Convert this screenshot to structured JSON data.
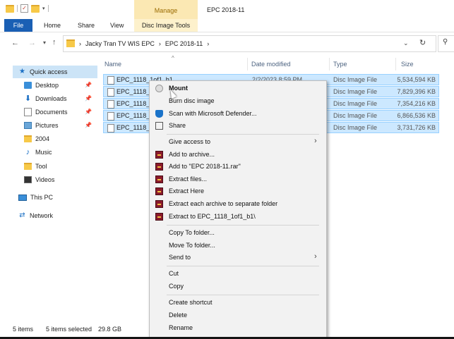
{
  "window": {
    "title": "EPC 2018-11",
    "manage_label": "Manage",
    "ribbon_tabs": [
      "File",
      "Home",
      "Share",
      "View",
      "Disc Image Tools"
    ]
  },
  "address": {
    "crumbs": [
      "Jacky Tran TV WIS EPC",
      "EPC 2018-11"
    ]
  },
  "nav": {
    "quick_access": "Quick access",
    "items": [
      "Desktop",
      "Downloads",
      "Documents",
      "Pictures",
      "2004",
      "Music",
      "Tool",
      "Videos"
    ],
    "this_pc": "This PC",
    "network": "Network"
  },
  "columns": {
    "name": "Name",
    "date": "Date modified",
    "type": "Type",
    "size": "Size"
  },
  "files": [
    {
      "name": "EPC_1118_1of1_b1",
      "date": "2/2/2023 8:59 PM",
      "type": "Disc Image File",
      "size": "5,534,594 KB"
    },
    {
      "name": "EPC_1118_",
      "date": "",
      "type": "Disc Image File",
      "size": "7,829,396 KB"
    },
    {
      "name": "EPC_1118_2",
      "date": "",
      "type": "Disc Image File",
      "size": "7,354,216 KB"
    },
    {
      "name": "EPC_1118_",
      "date": "",
      "type": "Disc Image File",
      "size": "6,866,536 KB"
    },
    {
      "name": "EPC_1118_4",
      "date": "",
      "type": "Disc Image File",
      "size": "3,731,726 KB"
    }
  ],
  "status": {
    "count": "5 items",
    "selected": "5 items selected",
    "size": "29.8 GB"
  },
  "context_menu": {
    "mount": "Mount",
    "burn": "Burn disc image",
    "defender": "Scan with Microsoft Defender...",
    "share": "Share",
    "give_access": "Give access to",
    "add_archive": "Add to archive...",
    "add_rar": "Add to \"EPC 2018-11.rar\"",
    "extract_files": "Extract files...",
    "extract_here": "Extract Here",
    "extract_each": "Extract each archive to separate folder",
    "extract_to": "Extract to EPC_1118_1of1_b1\\",
    "copy_to": "Copy To folder...",
    "move_to": "Move To folder...",
    "send_to": "Send to",
    "cut": "Cut",
    "copy": "Copy",
    "create_shortcut": "Create shortcut",
    "delete": "Delete",
    "rename": "Rename"
  },
  "colors": {
    "selection_bg": "#cce8ff",
    "file_tab": "#1a5fb4",
    "manage_tab": "#fbe8b3"
  }
}
